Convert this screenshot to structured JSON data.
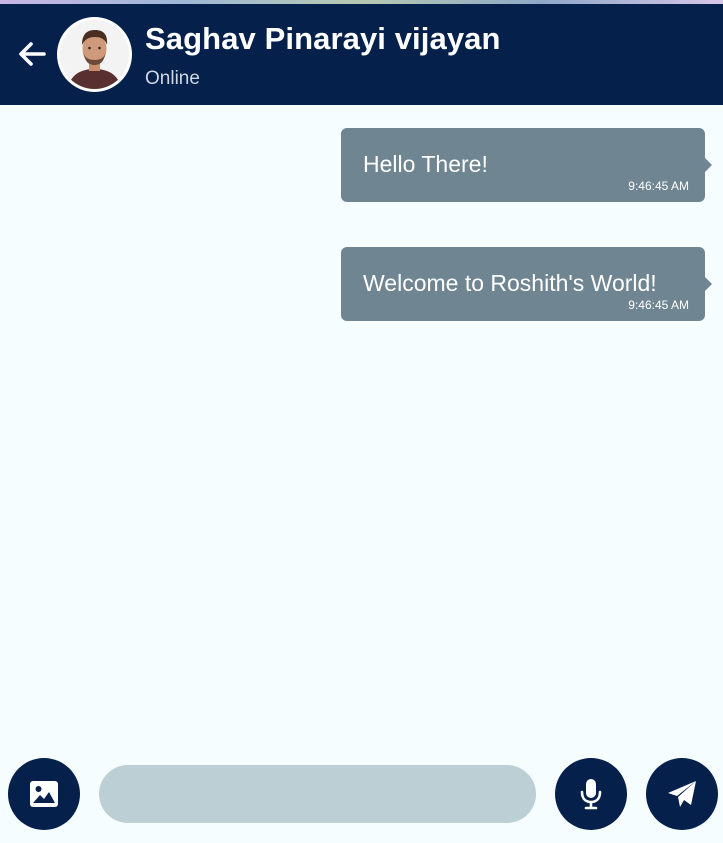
{
  "header": {
    "contact_name": "Saghav Pinarayi vijayan",
    "status": "Online",
    "back_icon": "arrow-left-icon",
    "avatar_icon": "person-avatar"
  },
  "messages": [
    {
      "text": "Hello There!",
      "time": "9:46:45 AM",
      "direction": "outgoing"
    },
    {
      "text": "Welcome to Roshith's World!",
      "time": "9:46:45 AM",
      "direction": "outgoing"
    }
  ],
  "composer": {
    "input_value": "",
    "input_placeholder": "",
    "image_icon": "image-icon",
    "mic_icon": "microphone-icon",
    "send_icon": "send-icon"
  },
  "colors": {
    "header_bg": "#04204b",
    "chat_bg": "#f5fdff",
    "bubble_bg": "#6f8592",
    "input_bg": "#bccfd5"
  }
}
